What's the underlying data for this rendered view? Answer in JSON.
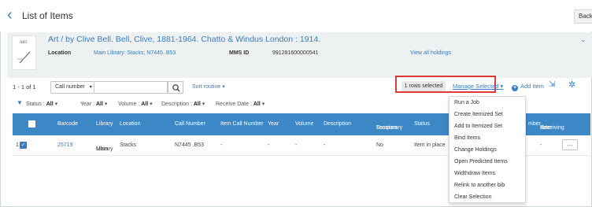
{
  "topbar": {
    "title": "List of Items",
    "back_label": "Back"
  },
  "record": {
    "thumb_text": "ART",
    "title": "Art / by Clive Bell. Bell, Clive, 1881-1964. Chatto & Windus London : 1914.",
    "location_label": "Location",
    "location_value": "Main Library: Stacks; N7445 .B53",
    "mms_label": "MMS ID",
    "mms_value": "991281600000541",
    "holdings_link": "View all holdings"
  },
  "toolbar": {
    "count": "1 - 1 of 1",
    "search_field": "Call number",
    "search_value": "",
    "sort_label": "Sort routine",
    "rows_selected": "1 rows selected",
    "manage_selected": "Manage Selected",
    "add_item": "Add Item"
  },
  "filters": [
    {
      "label": "Status",
      "value": "All"
    },
    {
      "label": "Year",
      "value": "All"
    },
    {
      "label": "Volume",
      "value": "All"
    },
    {
      "label": "Description",
      "value": "All"
    },
    {
      "label": "Receive Date",
      "value": "All"
    }
  ],
  "table": {
    "headers": {
      "barcode": "Barcode",
      "library": "Library",
      "location": "Location",
      "call_number": "Call Number",
      "item_call_number": "Item Call Number",
      "year": "Year",
      "volume": "Volume",
      "description": "Description",
      "temp_location_1": "Temporary",
      "temp_location_2": "Location",
      "status": "Status",
      "number_partial": "mber",
      "receiving_1": "Receiving",
      "receiving_2": "date"
    },
    "rows": [
      {
        "num": "1",
        "barcode": "25719",
        "library_1": "Main",
        "library_2": "Library",
        "location": "Stacks",
        "call_number": "N7445 .B53",
        "item_call_number": "-",
        "year": "-",
        "volume": "-",
        "description": "-",
        "temp_location": "No",
        "status": "Item in place",
        "receiving": "-",
        "more": "..."
      }
    ]
  },
  "menu": {
    "items": [
      "Run a Job",
      "Create Itemized Set",
      "Add to Itemized Set",
      "Bind Items",
      "Change Holdings",
      "Open Predicted Items",
      "Widthdraw Items",
      "Relink to another bib",
      "Clear Selection"
    ]
  },
  "colors": {
    "accent": "#3a7cc2",
    "table_header": "#3c87c6",
    "highlight_border": "#e03a3a"
  }
}
